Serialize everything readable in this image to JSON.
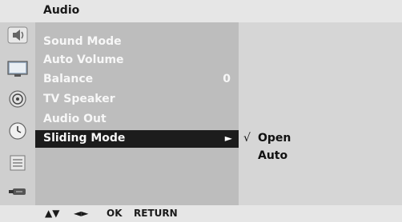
{
  "title": "Audio",
  "icons": [
    "speaker-icon",
    "picture-icon",
    "setup-icon",
    "timer-icon",
    "lock-icon",
    "input-icon"
  ],
  "menu": {
    "items": [
      {
        "label": "Sound Mode",
        "value": ""
      },
      {
        "label": "Auto Volume",
        "value": ""
      },
      {
        "label": "Balance",
        "value": "0"
      },
      {
        "label": "TV Speaker",
        "value": ""
      },
      {
        "label": "Audio Out",
        "value": ""
      },
      {
        "label": "Sliding Mode",
        "value": "",
        "arrow": "►"
      }
    ],
    "selected_index": 5
  },
  "submenu": {
    "items": [
      {
        "check": "√",
        "label": "Open"
      },
      {
        "check": "",
        "label": "Auto"
      }
    ]
  },
  "footer": {
    "updown": "▲▼",
    "leftright": "◄►",
    "ok": "OK",
    "return": "RETURN"
  }
}
